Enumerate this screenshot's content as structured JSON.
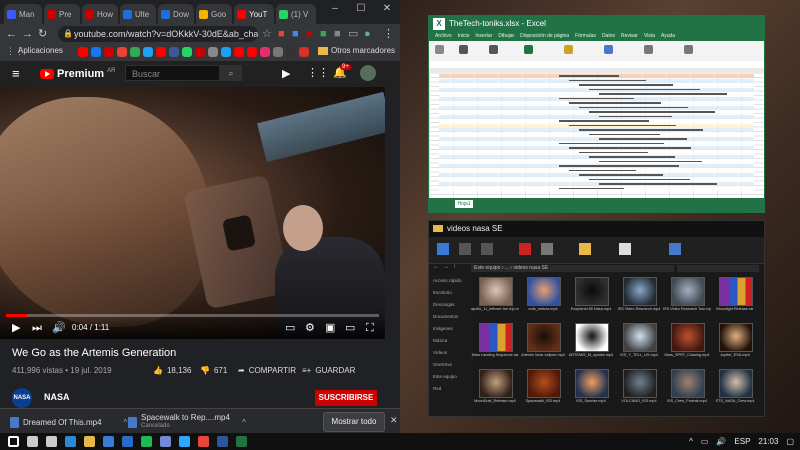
{
  "browser": {
    "tabs": [
      {
        "label": "Man",
        "color": "#3d5afe"
      },
      {
        "label": "Pre",
        "color": "#c00"
      },
      {
        "label": "How",
        "color": "#c00"
      },
      {
        "label": "Ulte",
        "color": "#1e6fd9"
      },
      {
        "label": "Dow",
        "color": "#1e6fd9"
      },
      {
        "label": "Goo",
        "color": "#f4b400"
      },
      {
        "label": "YouT",
        "color": "#f00"
      },
      {
        "label": "(1) V",
        "color": "#25d366"
      }
    ],
    "window_controls": [
      "–",
      "☐",
      "✕"
    ],
    "url": "youtube.com/watch?v=dOKkkV-30dE&ab_chann...",
    "bookmarks_label": "Aplicaciones",
    "other_bookmarks": "Otros marcadores",
    "bookmark_colors": [
      "#f00",
      "#1877f2",
      "#c00",
      "#ea4335",
      "#34a853",
      "#1da1f2",
      "#f00",
      "#3b5998",
      "#25d366",
      "#c00",
      "#888",
      "#1da1f2",
      "#f00",
      "#ff0000",
      "#e1306c",
      "#777",
      "#333",
      "#d93025"
    ]
  },
  "youtube": {
    "brand": "Premium",
    "region": "AR",
    "search_placeholder": "Buscar",
    "notifications": "9+",
    "video": {
      "time_current": "0:04",
      "time_total": "1:11",
      "progress_fraction": 0.056
    },
    "title": "We Go as the Artemis Generation",
    "stats": "411,996 vistas • 19 jul. 2019",
    "likes": "18,136",
    "dislikes": "671",
    "share": "COMPARTIR",
    "save": "GUARDAR",
    "channel": "NASA",
    "channel_avatar_text": "NASA",
    "subscribe": "SUSCRIBIRSE"
  },
  "downloads": {
    "items": [
      {
        "name": "Dreamed Of This.mp4",
        "status": ""
      },
      {
        "name": "Spacewalk to Rep....mp4",
        "status": "Cancelado"
      }
    ],
    "show_all": "Mostrar todo"
  },
  "excel": {
    "title": "TheTech-toniks.xlsx - Excel",
    "icon_letter": "X",
    "tabs": [
      "Archivo",
      "Inicio",
      "Insertar",
      "Dibujar",
      "Disposición de página",
      "Fórmulas",
      "Datos",
      "Revisar",
      "Vista",
      "Ayuda"
    ],
    "sheet_tab": "Hoja1"
  },
  "explorer": {
    "title": "videos nasa SE",
    "address": "Este equipo › ... › videos nasa SE",
    "nav": [
      "Acceso rápido",
      "Escritorio",
      "Descargas",
      "Documentos",
      "Imágenes",
      "Música",
      "Vídeos",
      "OneDrive",
      "Este equipo",
      "Red"
    ],
    "files": [
      {
        "label": "apollo_11_leftover frm trip.mp4",
        "kind": "video",
        "c1": "#d8c8b8",
        "c2": "#7a6050"
      },
      {
        "label": "crab_nebula.mp4",
        "kind": "video",
        "c1": "#e8a070",
        "c2": "#3050a0"
      },
      {
        "label": "Exoplanet 89 Nasa.mp4",
        "kind": "video",
        "c1": "#0a0a0a",
        "c2": "#303030"
      },
      {
        "label": "ISS Video Research.mp4",
        "kind": "video",
        "c1": "#8aa8c8",
        "c2": "#202830"
      },
      {
        "label": "ISS Video Research Tour.mp4",
        "kind": "video",
        "c1": "#a0b0c0",
        "c2": "#404850"
      },
      {
        "label": "Moonlight Release.rar",
        "kind": "rar",
        "c1": "",
        "c2": ""
      },
      {
        "label": "Mars Landing Sequence.rar",
        "kind": "rar",
        "c1": "",
        "c2": ""
      },
      {
        "label": "Artemis lunar eclipse.mp4",
        "kind": "video",
        "c1": "#1a0e08",
        "c2": "#603018"
      },
      {
        "label": "ARTEMIS_M_update.mp4",
        "kind": "video",
        "c1": "#101010",
        "c2": "#fff"
      },
      {
        "label": "ISS_Y_TELL_US.mp4",
        "kind": "video",
        "c1": "#d0e0f0",
        "c2": "#404040"
      },
      {
        "label": "Mars_SPRT_Chasing.mp4",
        "kind": "video",
        "c1": "#c05030",
        "c2": "#401810"
      },
      {
        "label": "Jupiter_ESA.mp4",
        "kind": "video",
        "c1": "#e0b080",
        "c2": "#201008"
      },
      {
        "label": "MoonDust_Release.mp4",
        "kind": "video",
        "c1": "#c0a080",
        "c2": "#302018"
      },
      {
        "label": "Spacewalk_ISS.mp4",
        "kind": "video",
        "c1": "#b05020",
        "c2": "#501808"
      },
      {
        "label": "ISS_Sunrise.mp4",
        "kind": "video",
        "c1": "#f0a060",
        "c2": "#203050"
      },
      {
        "label": "VOLCANO_ISS.mp4",
        "kind": "video",
        "c1": "#708090",
        "c2": "#202020"
      },
      {
        "label": "ISS_Crew_Portrait.mp4",
        "kind": "video",
        "c1": "#a08070",
        "c2": "#304050"
      },
      {
        "label": "STS_NASA_Crew.mp4",
        "kind": "video",
        "c1": "#d0c0b0",
        "c2": "#203040"
      }
    ]
  },
  "taskbar": {
    "apps": [
      {
        "name": "start",
        "color": "#ffffff"
      },
      {
        "name": "search",
        "color": "#cccccc"
      },
      {
        "name": "taskview",
        "color": "#cccccc"
      },
      {
        "name": "edge",
        "color": "#2a8ad4"
      },
      {
        "name": "explorer",
        "color": "#e8b84a"
      },
      {
        "name": "store",
        "color": "#3a7bd5"
      },
      {
        "name": "mail",
        "color": "#2a6ac8"
      },
      {
        "name": "spotify",
        "color": "#1db954"
      },
      {
        "name": "discord",
        "color": "#7289da"
      },
      {
        "name": "photoshop",
        "color": "#31a8ff"
      },
      {
        "name": "chrome",
        "color": "#e8453c"
      },
      {
        "name": "word",
        "color": "#2b579a"
      },
      {
        "name": "excel",
        "color": "#217346"
      }
    ],
    "language": "ESP",
    "time": "21:03"
  }
}
